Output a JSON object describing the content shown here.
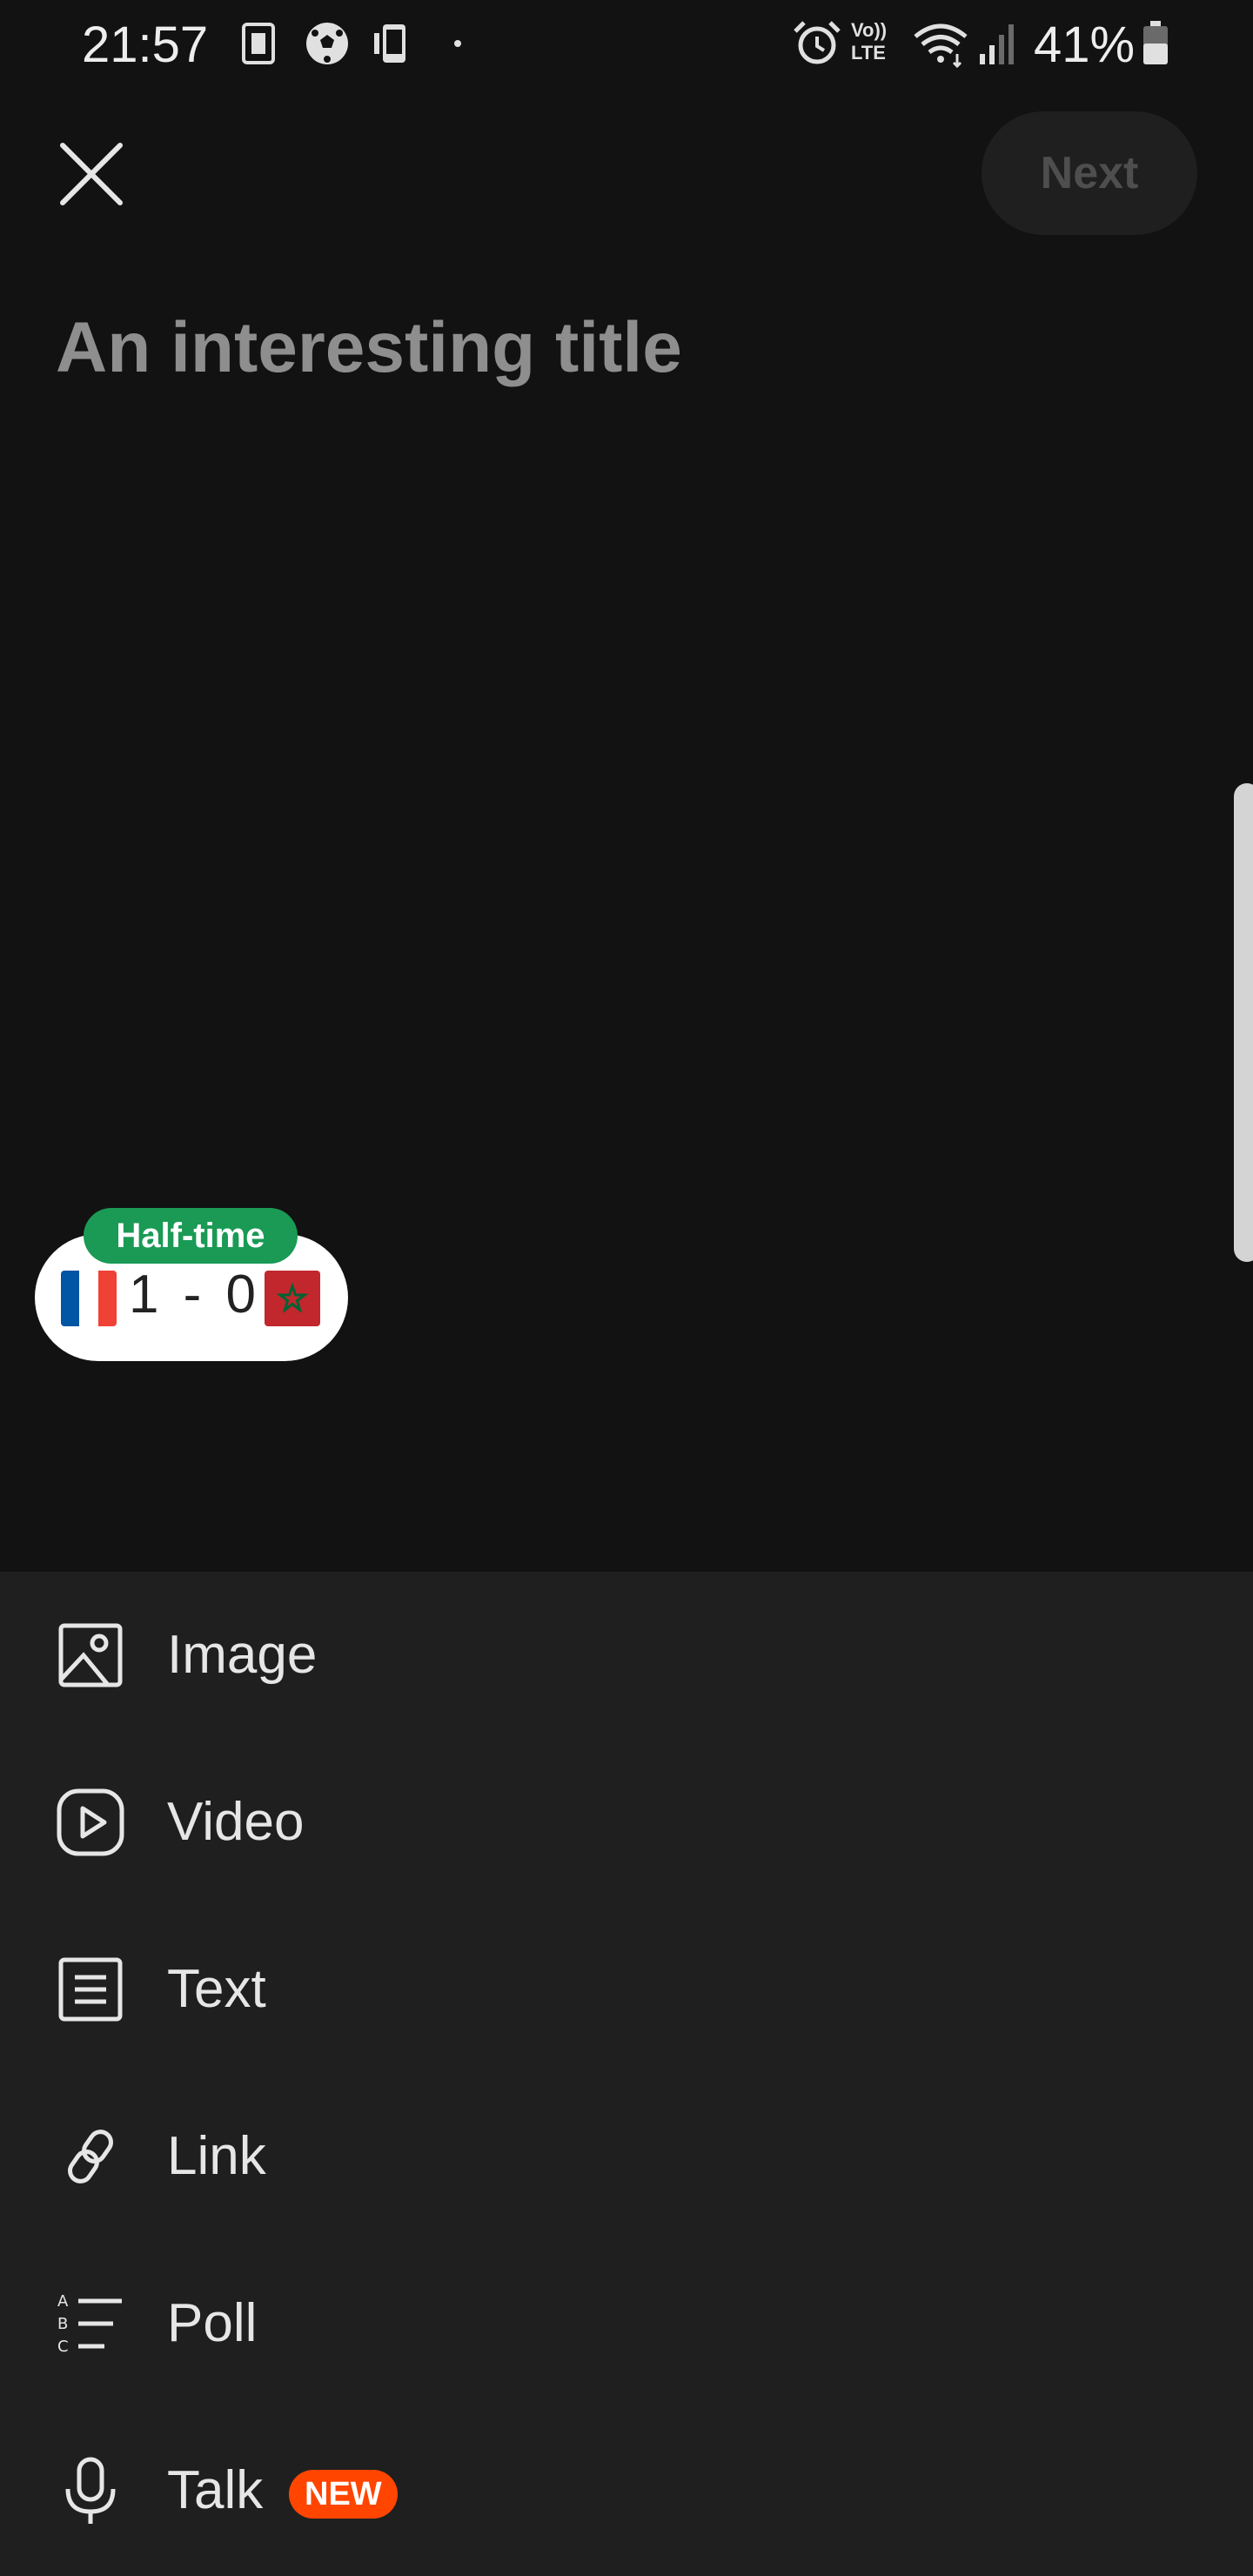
{
  "status_bar": {
    "time": "21:57",
    "battery": "41%",
    "icons": [
      "sim-card-icon",
      "soccer-ball-icon",
      "phone-vibrate-icon",
      "dot-icon",
      "alarm-icon",
      "volte-icon",
      "wifi-icon",
      "signal-icon",
      "battery-icon"
    ],
    "volte_top": "Vo))",
    "volte_bottom": "LTE"
  },
  "header": {
    "close_icon": "close-icon",
    "next_label": "Next"
  },
  "title_input": {
    "value": "",
    "placeholder": "An interesting title"
  },
  "score_widget": {
    "status": "Half-time",
    "home_score": "1",
    "separator": "-",
    "away_score": "0",
    "home_flag": "france-flag-icon",
    "away_flag": "morocco-flag-icon",
    "colors": {
      "badge": "#1a9a55",
      "france": [
        "#0055a4",
        "#ffffff",
        "#ef4135"
      ],
      "morocco": "#c1272d",
      "morocco_star": "#006233"
    }
  },
  "post_types": [
    {
      "label": "Image",
      "icon": "image-icon"
    },
    {
      "label": "Video",
      "icon": "video-play-icon"
    },
    {
      "label": "Text",
      "icon": "text-document-icon"
    },
    {
      "label": "Link",
      "icon": "link-icon"
    },
    {
      "label": "Poll",
      "icon": "poll-list-icon"
    },
    {
      "label": "Talk",
      "icon": "microphone-icon",
      "badge": "NEW"
    }
  ],
  "colors": {
    "background": "#121212",
    "sheet": "#1f1f1f",
    "new_badge": "#ff4500"
  }
}
